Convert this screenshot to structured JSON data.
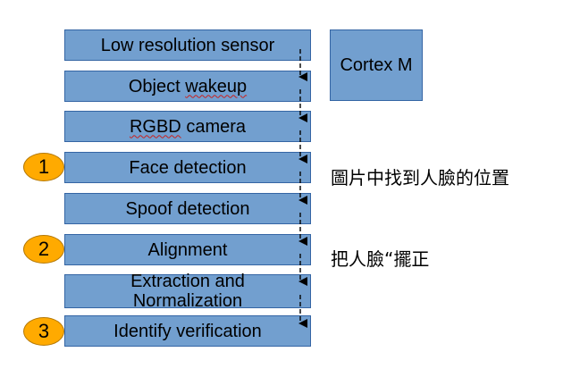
{
  "steps": {
    "s1": "Low resolution sensor",
    "s2_pre": "Object ",
    "s2_wavy": "wakeup",
    "s3": "RGBD",
    "s3_post": " camera",
    "s4": "Face detection",
    "s5": "Spoof detection",
    "s6": "Alignment",
    "s7_line1": "Extraction and",
    "s7_line2": "Normalization",
    "s8": "Identify verification"
  },
  "cortex_label": "Cortex M",
  "badges": [
    "1",
    "2",
    "3"
  ],
  "notes": {
    "face": "圖片中找到人臉的位置",
    "align": "把人臉“擺正"
  },
  "colors": {
    "box_fill": "#729fcf",
    "box_border": "#3465a4",
    "badge_fill": "#ffaa00",
    "spell_underline": "#c9211e"
  }
}
